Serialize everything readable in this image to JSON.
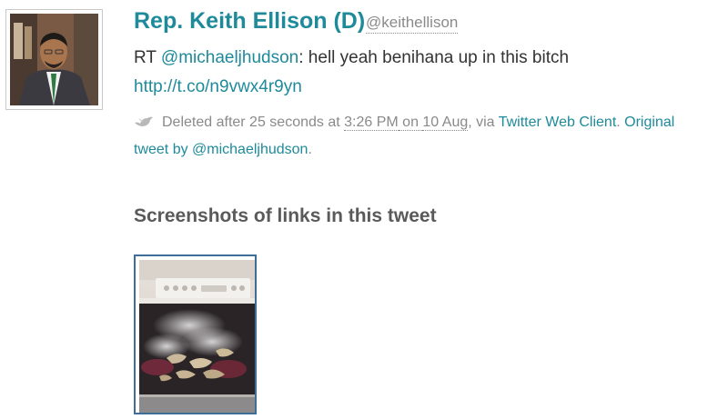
{
  "tweet": {
    "author_name": "Rep. Keith Ellison (D)",
    "author_handle": "@keithellison",
    "text_prefix": "RT ",
    "mention": "@michaeljhudson",
    "text_rest": ": hell yeah benihana up in this bitch",
    "url": "http://t.co/n9vwx4r9yn"
  },
  "meta": {
    "deleted_prefix": "Deleted after 25 seconds at ",
    "time": "3:26 PM",
    "on_text": " on ",
    "date": "10 Aug",
    "via_text": ", via ",
    "client": "Twitter Web Client",
    "sep": ". ",
    "original_label": "Original",
    "line2_a": "tweet by ",
    "original_author": "@michaeljhudson",
    "line2_end": "."
  },
  "screenshots": {
    "heading": "Screenshots of links in this tweet"
  },
  "colors": {
    "link": "#1e8a9a",
    "text": "#333333",
    "meta": "#8a8a8a",
    "heading": "#5a5a5a",
    "thumb_border": "#3e6d97"
  },
  "icons": {
    "avatar": "person-photo",
    "bird": "bird-icon",
    "thumbnail": "stove-photo"
  }
}
